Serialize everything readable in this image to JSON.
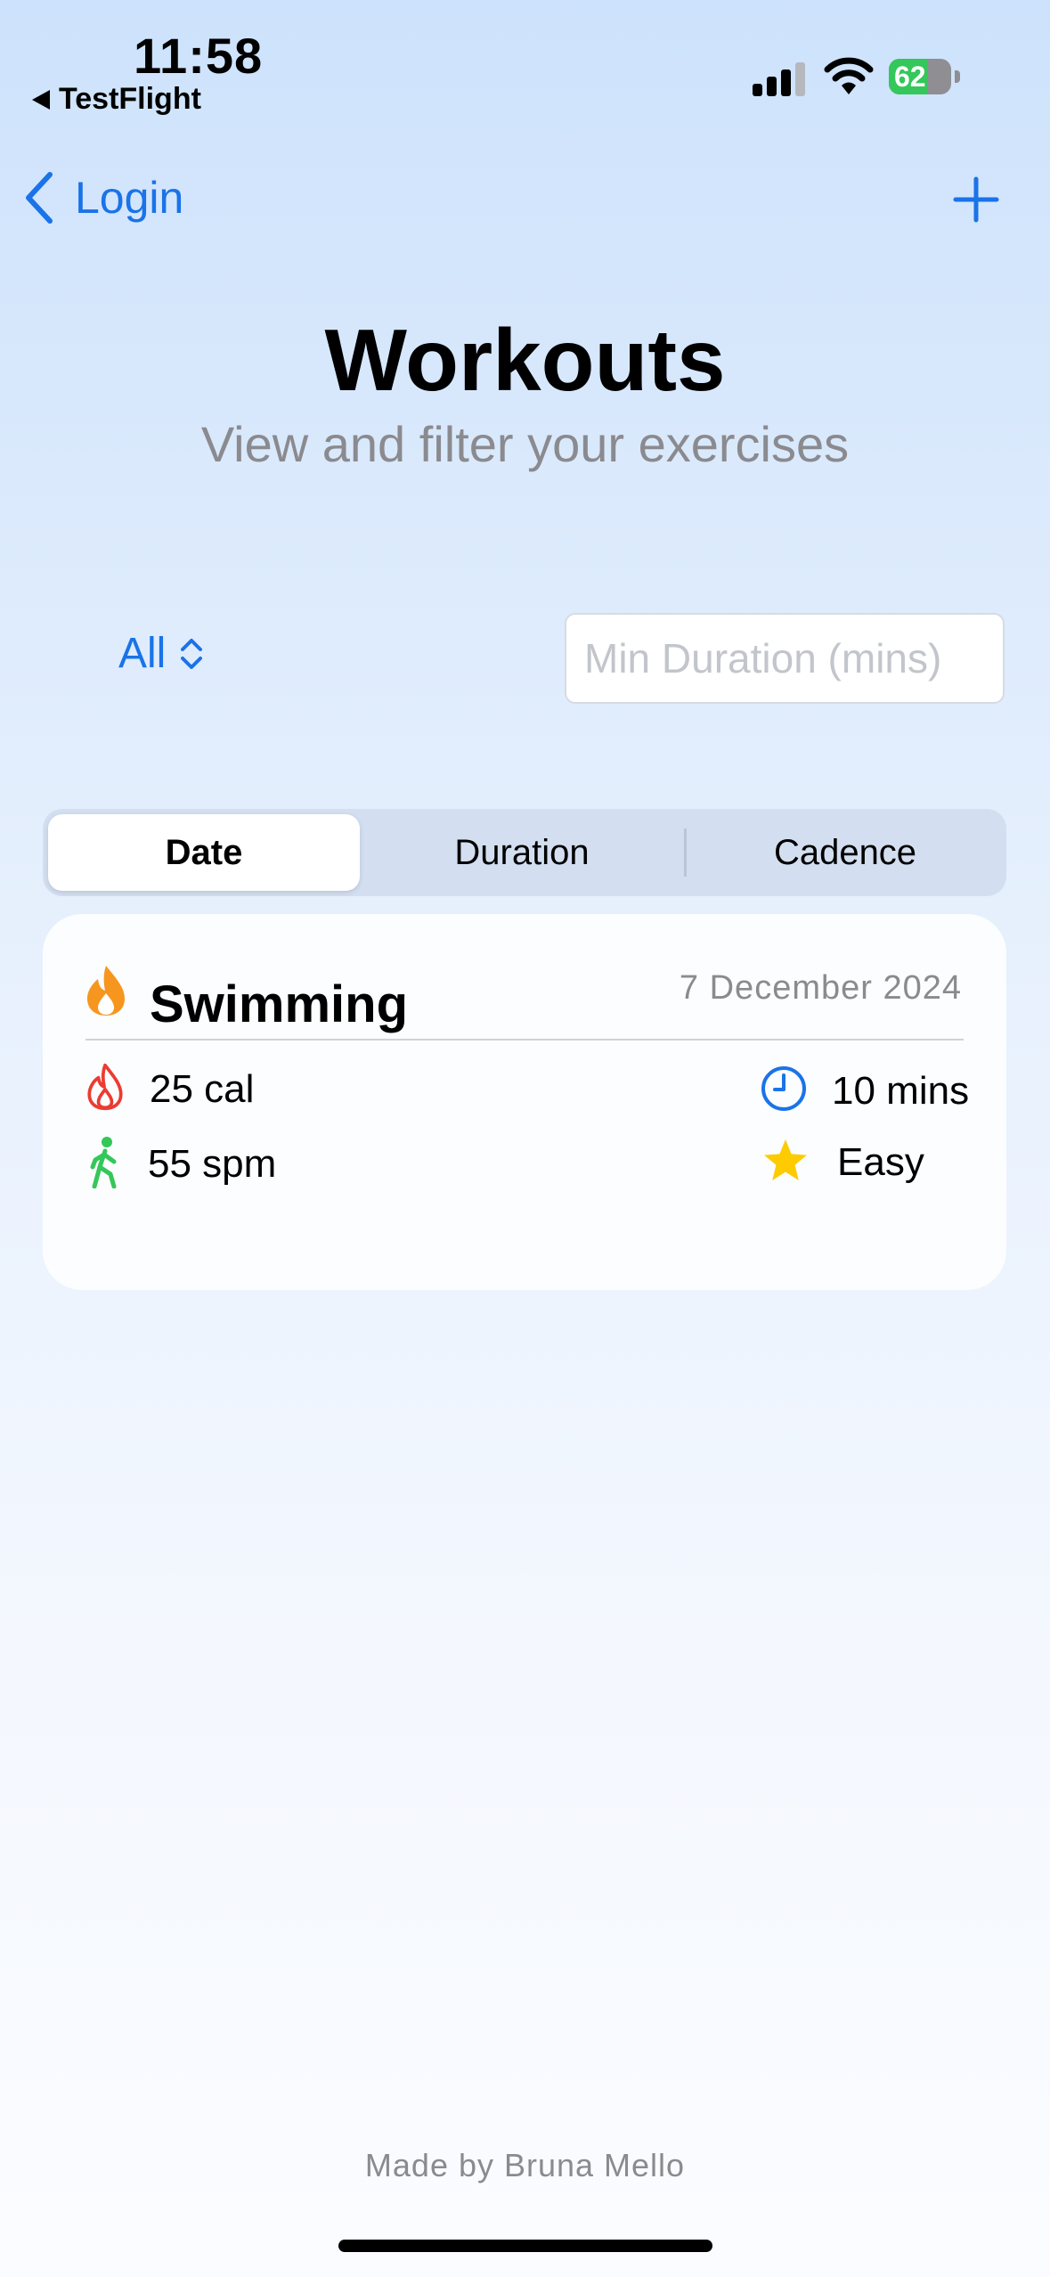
{
  "status_bar": {
    "time": "11:58",
    "back_app": "TestFlight",
    "battery_percent": 62,
    "battery_label": "62"
  },
  "nav": {
    "back_label": "Login"
  },
  "header": {
    "title": "Workouts",
    "subtitle": "View and filter your exercises"
  },
  "filters": {
    "type_picker_value": "All",
    "min_duration_placeholder": "Min Duration (mins)",
    "min_duration_value": ""
  },
  "sort": {
    "options": [
      "Date",
      "Duration",
      "Cadence"
    ],
    "selected": "Date"
  },
  "workouts": [
    {
      "name": "Swimming",
      "date": "7 December 2024",
      "calories": "25 cal",
      "duration": "10 mins",
      "cadence": "55 spm",
      "difficulty": "Easy"
    }
  ],
  "footer": {
    "credit": "Made by Bruna Mello"
  },
  "colors": {
    "accent": "#1a73e8",
    "flame_orange": "#f7961e",
    "calorie_red": "#ec3b32",
    "walk_green": "#34c759",
    "star_yellow": "#fecb00",
    "battery_green": "#34c759"
  },
  "icons": {
    "workout": "flame-icon",
    "calories": "flame-outline-icon",
    "duration": "clock-icon",
    "cadence": "figure-walk-icon",
    "difficulty": "star-icon"
  }
}
